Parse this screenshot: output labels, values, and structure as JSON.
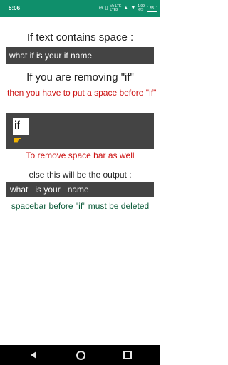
{
  "status_bar": {
    "time": "5:06",
    "network_top": "Vo LTE",
    "network_bottom": "LTE2",
    "data_speed_value": "1.99",
    "data_speed_unit": "K/S",
    "battery": "55"
  },
  "section1": {
    "heading": "If text contains space :",
    "display_text": "what if is your if name"
  },
  "section2": {
    "heading": "If you are removing \"if\"",
    "instruction": "then you have to put a space before \"if\"",
    "input_value": "if",
    "note": "To remove space bar as well"
  },
  "section3": {
    "heading": "else this will be the output :",
    "output_text": "what   is your   name",
    "footer_note": "spacebar before \"if\" must be deleted"
  },
  "colors": {
    "status_bar": "#0f8f6b",
    "dark_bar": "#444444",
    "red_text": "#cc1111",
    "nav_bar": "#000000"
  },
  "icons": {
    "pointer": "tap-hand-icon",
    "signal": "signal-icon",
    "wifi": "wifi-icon",
    "battery": "battery-icon"
  }
}
